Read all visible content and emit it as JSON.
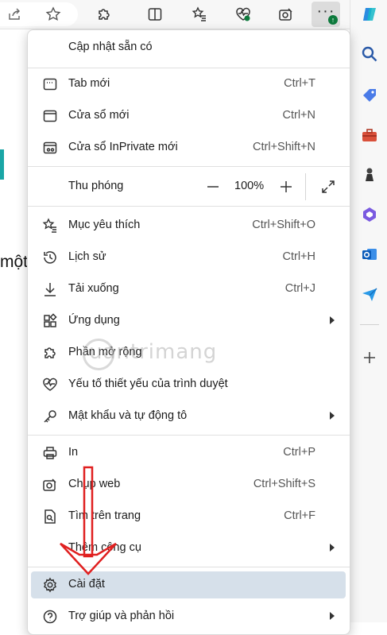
{
  "menu": {
    "update": "Cập nhật sẵn có",
    "new_tab": {
      "label": "Tab mới",
      "shortcut": "Ctrl+T"
    },
    "new_window": {
      "label": "Cửa sổ mới",
      "shortcut": "Ctrl+N"
    },
    "inprivate": {
      "label": "Cửa sổ InPrivate mới",
      "shortcut": "Ctrl+Shift+N"
    },
    "zoom": {
      "label": "Thu phóng",
      "value": "100%"
    },
    "favorites": {
      "label": "Mục yêu thích",
      "shortcut": "Ctrl+Shift+O"
    },
    "history": {
      "label": "Lịch sử",
      "shortcut": "Ctrl+H"
    },
    "downloads": {
      "label": "Tải xuống",
      "shortcut": "Ctrl+J"
    },
    "apps": {
      "label": "Ứng dụng"
    },
    "extensions": {
      "label": "Phần mở rộng"
    },
    "essentials": {
      "label": "Yếu tố thiết yếu của trình duyệt"
    },
    "passwords": {
      "label": "Mật khẩu và tự động tô"
    },
    "print": {
      "label": "In",
      "shortcut": "Ctrl+P"
    },
    "screenshot": {
      "label": "Chụp web",
      "shortcut": "Ctrl+Shift+S"
    },
    "find": {
      "label": "Tìm trên trang",
      "shortcut": "Ctrl+F"
    },
    "more_tools": {
      "label": "Thêm công cụ"
    },
    "settings": {
      "label": "Cài đặt"
    },
    "help": {
      "label": "Trợ giúp và phản hồi"
    }
  },
  "page": {
    "partial_text": "một"
  },
  "watermark": "uantrimang",
  "icons": {
    "toolbar": [
      "share-icon",
      "favorite-star-icon",
      "extensions-icon",
      "split-screen-icon",
      "favorites-list-icon",
      "browser-essentials-icon",
      "screenshot-icon",
      "more-icon"
    ],
    "sidebar": [
      "copilot-icon",
      "search-icon",
      "shopping-tag-icon",
      "tools-icon",
      "games-icon",
      "microsoft365-icon",
      "outlook-icon",
      "drop-icon",
      "add-icon"
    ]
  },
  "colors": {
    "accent": "#0e7a3d",
    "highlight": "#d6e0ea",
    "arrow": "#e02020"
  }
}
